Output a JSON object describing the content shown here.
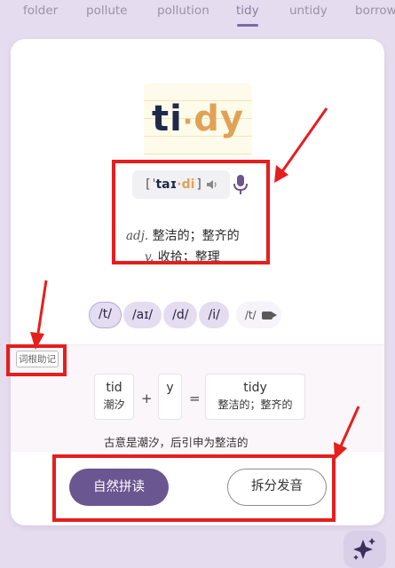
{
  "tabs": [
    {
      "label": "folder",
      "active": false
    },
    {
      "label": "pollute",
      "active": false
    },
    {
      "label": "pollution",
      "active": false
    },
    {
      "label": "tidy",
      "active": true
    },
    {
      "label": "untidy",
      "active": false
    },
    {
      "label": "borrow",
      "active": false
    }
  ],
  "word": {
    "part1": "ti",
    "dot": "·",
    "part2": "dy"
  },
  "phonetic": {
    "open": "[",
    "stress": "ˈ",
    "part1": "taɪ",
    "dot": "·",
    "part2": "di",
    "close": "]"
  },
  "definitions": [
    {
      "pos": "adj.",
      "text": "整洁的；整齐的"
    },
    {
      "pos": "v.",
      "text": "收拾；整理"
    }
  ],
  "phonemes": [
    "/t/",
    "/aɪ/",
    "/d/",
    "/i/"
  ],
  "phoneme_video_label": "/t/",
  "root_tag": "词根助记",
  "etymology": {
    "root": {
      "word": "tid",
      "meaning": "潮汐"
    },
    "suffix": {
      "word": "y",
      "meaning": ""
    },
    "plus": "+",
    "equals": "=",
    "result": {
      "word": "tidy",
      "meaning": "整洁的；整齐的"
    },
    "note": "古意是潮汐，后引申为整洁的"
  },
  "buttons": {
    "phonics": "自然拼读",
    "split": "拆分发音"
  },
  "colors": {
    "accent": "#6a5690",
    "highlight_red": "#e61e1e",
    "word_dark": "#1e2a4a",
    "word_orange": "#e0a257"
  },
  "icons": [
    "speaker-icon",
    "microphone-icon",
    "video-camera-icon",
    "sparkle-icon"
  ]
}
